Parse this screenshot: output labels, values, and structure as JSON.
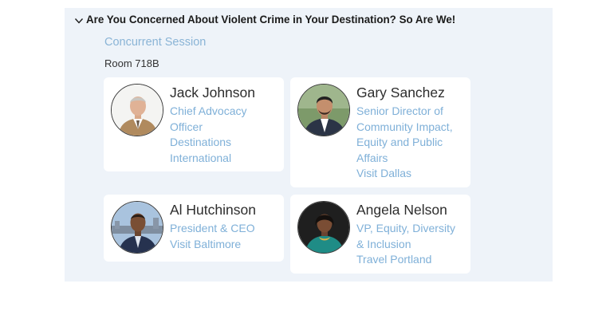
{
  "session": {
    "title": "Are You Concerned About Violent Crime in Your Destination? So Are We!",
    "type": "Concurrent Session",
    "room": "Room 718B"
  },
  "speakers": [
    {
      "name": "Jack Johnson",
      "lines": [
        "Chief Advocacy",
        "Officer",
        "Destinations",
        "International"
      ]
    },
    {
      "name": "Gary Sanchez",
      "lines": [
        "Senior Director of",
        "Community Impact,",
        "Equity and Public",
        "Affairs",
        "Visit Dallas"
      ]
    },
    {
      "name": "Al Hutchinson",
      "lines": [
        "President & CEO",
        "Visit Baltimore"
      ]
    },
    {
      "name": "Angela Nelson",
      "lines": [
        "VP, Equity, Diversity",
        "& Inclusion",
        "Travel Portland"
      ]
    }
  ],
  "icons": {
    "collapse": "chevron-down-icon"
  },
  "colors": {
    "panel_background": "#eef3f9",
    "link_blue": "#7fb0d8",
    "title_text": "#1b1b1b"
  }
}
